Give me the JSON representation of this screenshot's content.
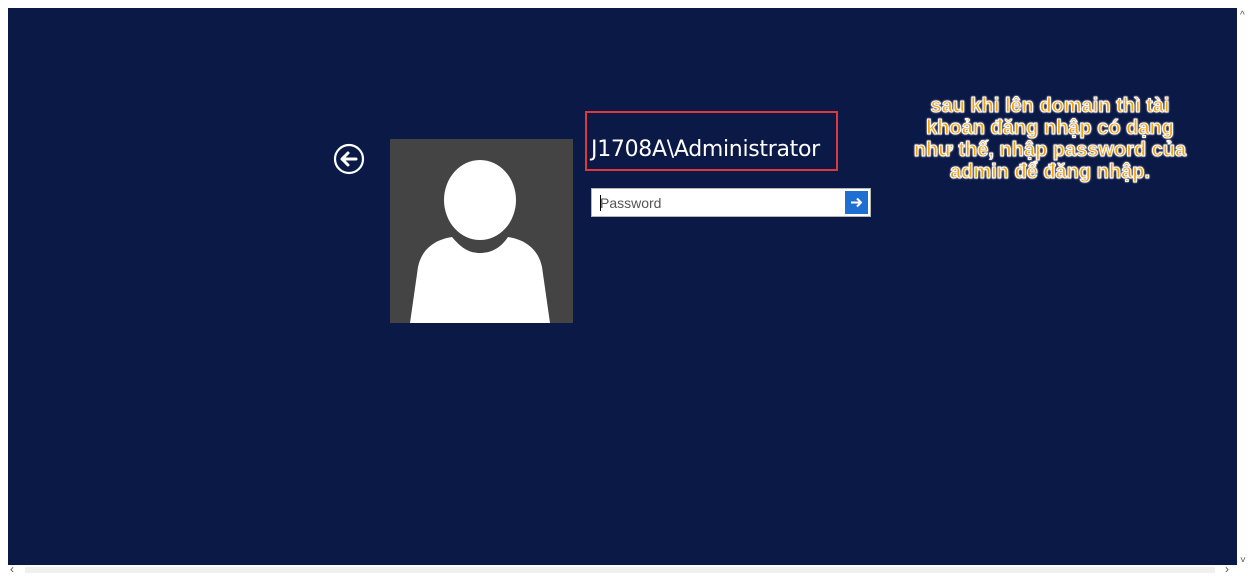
{
  "login": {
    "username": "J1708A\\Administrator",
    "password_placeholder": "Password",
    "password_value": ""
  },
  "annotation": {
    "text": "sau khi lên domain thì tài khoản đăng nhập có dạng như thế, nhập password của admin để đăng nhập.",
    "color": "#f5a10f"
  },
  "colors": {
    "background": "#0b1946",
    "avatar_bg": "#444444",
    "submit_button": "#1f6fd2",
    "highlight_border": "#e0383a"
  },
  "icons": {
    "back": "back-arrow-circle-icon",
    "avatar": "user-silhouette-icon",
    "submit": "arrow-right-icon"
  },
  "scrollbar": {
    "up": "^",
    "down": "˅",
    "left": "‹",
    "right": "›"
  }
}
